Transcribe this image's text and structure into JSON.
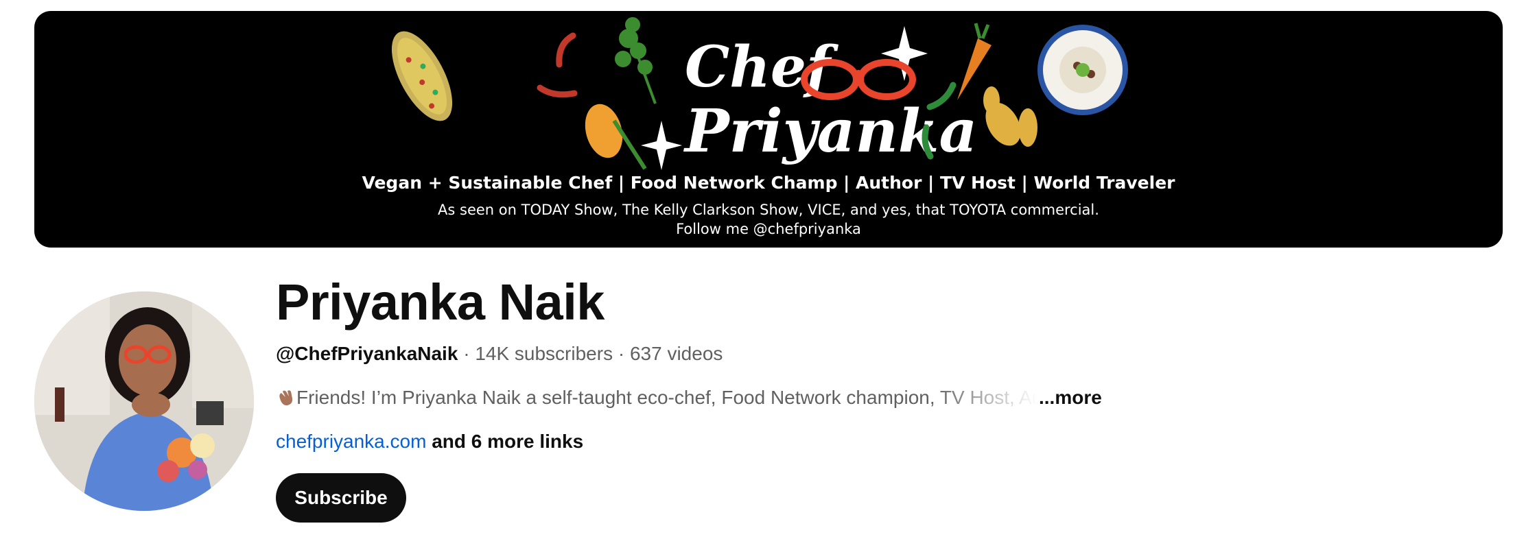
{
  "banner": {
    "logo_line1": "Chef",
    "logo_line2": "Priyanka",
    "tagline": "Vegan + Sustainable Chef | Food Network Champ | Author | TV Host | World Traveler",
    "seen_on": "As seen on TODAY Show, The Kelly Clarkson Show, VICE, and yes, that TOYOTA commercial.",
    "follow": "Follow me @chefpriyanka"
  },
  "channel": {
    "name": "Priyanka Naik",
    "handle": "@ChefPriyankaNaik",
    "separator": " · ",
    "subscribers": "14K subscribers",
    "videos": "637 videos",
    "description": "Friends! I’m Priyanka Naik a self-taught eco-chef, Food Network champion, TV Host, Author",
    "more_label": "...more",
    "link_text": "chefpriyanka.com",
    "more_links": "and 6 more links",
    "subscribe_label": "Subscribe"
  },
  "icons": {
    "description_emoji": "waving-hand-icon"
  },
  "colors": {
    "banner_bg": "#000000",
    "link": "#065fd4",
    "subscribe_bg": "#0f0f0f",
    "glasses": "#e8452c"
  }
}
